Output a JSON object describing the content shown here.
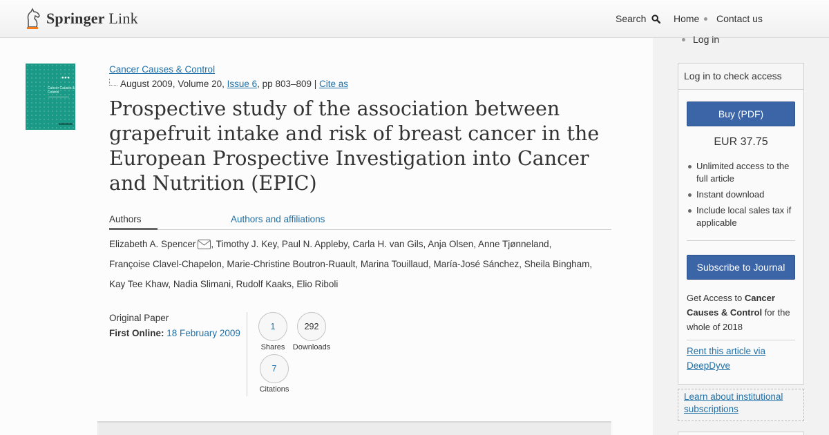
{
  "header": {
    "logo_brand": "Springer",
    "logo_suffix": "Link",
    "search_label": "Search",
    "nav": {
      "home": "Home",
      "contact": "Contact us",
      "login": "Log in"
    }
  },
  "article": {
    "journal": "Cancer Causes & Control",
    "date_volume": "August 2009, Volume 20,",
    "issue": "Issue 6",
    "pages": ", pp 803–809 |",
    "cite_as": "Cite as",
    "title": "Prospective study of the association between grapefruit intake and risk of breast cancer in the European Prospective Investigation into Cancer and Nutrition (EPIC)",
    "tabs": {
      "authors": "Authors",
      "affiliations": "Authors and affiliations"
    },
    "author_lines": [
      "Elizabeth A. Spencer",
      ", Timothy J. Key, Paul N. Appleby, Carla H. van Gils, Anja Olsen, Anne Tjønneland,",
      "Françoise Clavel-Chapelon, Marie-Christine Boutron-Ruault, Marina Touillaud, María-José Sánchez, Sheila Bingham,",
      "Kay Tee Khaw, Nadia Slimani, Rudolf Kaaks, Elio Riboli"
    ],
    "paper_type": "Original Paper",
    "first_online_label": "First Online:",
    "first_online_date": "18 February 2009",
    "metrics": {
      "shares_value": "1",
      "shares_label": "Shares",
      "downloads_value": "292",
      "downloads_label": "Downloads",
      "citations_value": "7",
      "citations_label": "Citations"
    }
  },
  "access": {
    "heading": "Log in to check access",
    "buy_label": "Buy (PDF)",
    "price": "EUR 37.75",
    "benefits": [
      "Unlimited access to the full article",
      "Instant download",
      "Include local sales tax if applicable"
    ],
    "subscribe_label": "Subscribe to Journal",
    "journal_access_prefix": "Get Access to ",
    "journal_access_name": "Cancer Causes & Control",
    "journal_access_suffix": " for the whole of 2018",
    "deepdyve": "Rent this article via DeepDyve",
    "institutional": "Learn about institutional subscriptions"
  },
  "colors": {
    "link": "#1f6fa7",
    "button": "#3b65a7",
    "cover": "#1a9a86"
  }
}
